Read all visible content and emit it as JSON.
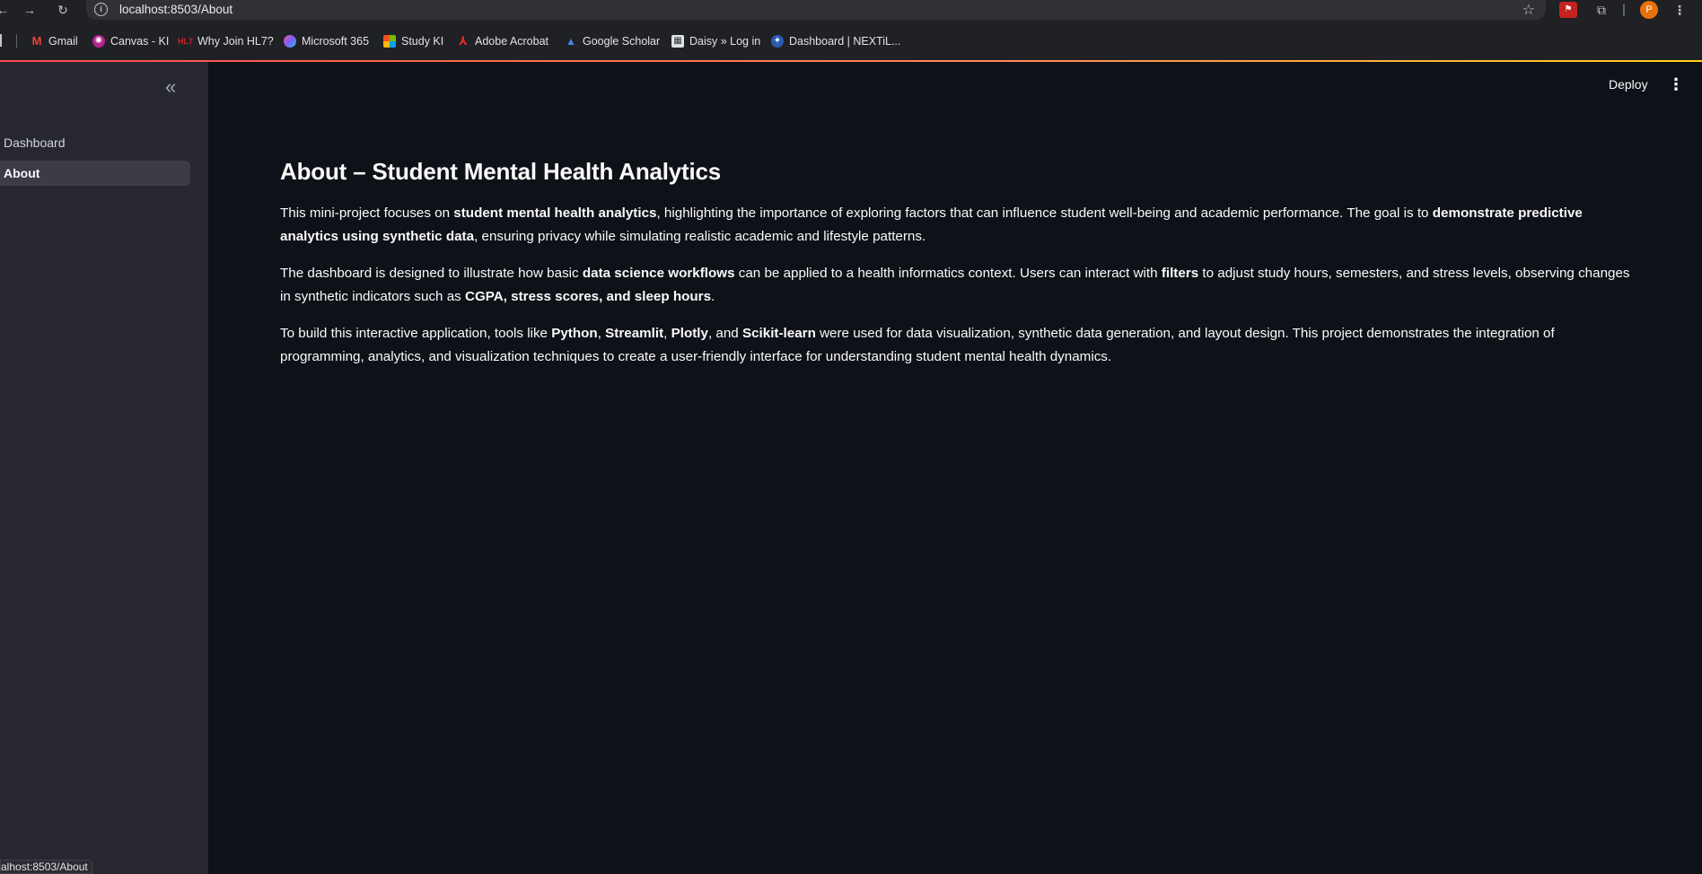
{
  "browser": {
    "url": "localhost:8503/About",
    "profile_initial": "P",
    "bookmarks": [
      {
        "label": "Gmail",
        "icon": "gmail-icon",
        "color": "#ea4335"
      },
      {
        "label": "Canvas - KI",
        "icon": "canvas-icon",
        "color": "#b5248c"
      },
      {
        "label": "Why Join HL7?",
        "icon": "hl7-icon",
        "color": "#d21f26"
      },
      {
        "label": "Microsoft 365",
        "icon": "microsoft365-icon",
        "color": "#7b5cf5"
      },
      {
        "label": "Study KI",
        "icon": "microsoft-icon",
        "color": "#f25022"
      },
      {
        "label": "Adobe Acrobat",
        "icon": "acrobat-icon",
        "color": "#d4151c"
      },
      {
        "label": "Google Scholar",
        "icon": "scholar-icon",
        "color": "#4285f4"
      },
      {
        "label": "Daisy » Log in",
        "icon": "daisy-icon",
        "color": "#dfe3ea"
      },
      {
        "label": "Dashboard | NEXTiL...",
        "icon": "nextil-icon",
        "color": "#2a5db0"
      }
    ],
    "status_url": "alhost:8503/About"
  },
  "app": {
    "sidebar": {
      "items": [
        {
          "label": "Dashboard",
          "active": false
        },
        {
          "label": "About",
          "active": true
        }
      ]
    },
    "header": {
      "deploy_label": "Deploy"
    },
    "page": {
      "title": "About – Student Mental Health Analytics",
      "paragraphs": [
        [
          {
            "t": "This mini-project focuses on ",
            "b": false
          },
          {
            "t": "student mental health analytics",
            "b": true
          },
          {
            "t": ", highlighting the importance of exploring factors that can influence student well-being and academic performance. The goal is to ",
            "b": false
          },
          {
            "t": "demonstrate predictive analytics using synthetic data",
            "b": true
          },
          {
            "t": ", ensuring privacy while simulating realistic academic and lifestyle patterns.",
            "b": false
          }
        ],
        [
          {
            "t": "The dashboard is designed to illustrate how basic ",
            "b": false
          },
          {
            "t": "data science workflows",
            "b": true
          },
          {
            "t": " can be applied to a health informatics context. Users can interact with ",
            "b": false
          },
          {
            "t": "filters",
            "b": true
          },
          {
            "t": " to adjust study hours, semesters, and stress levels, observing changes in synthetic indicators such as ",
            "b": false
          },
          {
            "t": "CGPA, stress scores, and sleep hours",
            "b": true
          },
          {
            "t": ".",
            "b": false
          }
        ],
        [
          {
            "t": "To build this interactive application, tools like ",
            "b": false
          },
          {
            "t": "Python",
            "b": true
          },
          {
            "t": ", ",
            "b": false
          },
          {
            "t": "Streamlit",
            "b": true
          },
          {
            "t": ", ",
            "b": false
          },
          {
            "t": "Plotly",
            "b": true
          },
          {
            "t": ", and ",
            "b": false
          },
          {
            "t": "Scikit-learn",
            "b": true
          },
          {
            "t": " were used for data visualization, synthetic data generation, and layout design. This project demonstrates the integration of programming, analytics, and visualization techniques to create a user-friendly interface for understanding student mental health dynamics.",
            "b": false
          }
        ]
      ]
    }
  }
}
